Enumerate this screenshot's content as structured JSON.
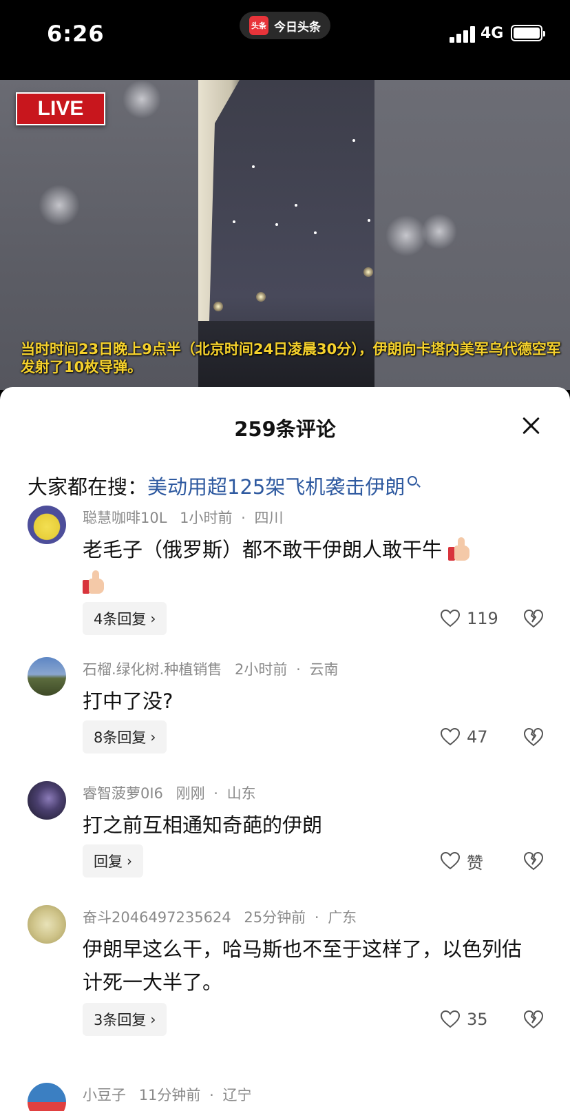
{
  "status_bar": {
    "time": "6:26",
    "app_logo_text": "头条",
    "app_name": "今日头条",
    "network": "4G"
  },
  "video": {
    "live_label": "LIVE",
    "caption": "当时时间23日晚上9点半（北京时间24日凌晨30分），伊朗向卡塔内美军乌代德空军发射了10枚导弹。"
  },
  "comments_sheet": {
    "title": "259条评论",
    "search_prefix": "大家都在搜：",
    "search_link": "美动用超125架飞机袭击伊朗",
    "comments": [
      {
        "user": "聪慧咖啡10L",
        "time": "1小时前",
        "location": "四川",
        "text": "老毛子（俄罗斯）都不敢干伊朗人敢干牛",
        "reply_label": "4条回复",
        "likes": "119"
      },
      {
        "user": "石榴.绿化树.种植销售",
        "time": "2小时前",
        "location": "云南",
        "text": "打中了没?",
        "reply_label": "8条回复",
        "likes": "47"
      },
      {
        "user": "睿智菠萝0I6",
        "time": "刚刚",
        "location": "山东",
        "text": "打之前互相通知奇葩的伊朗",
        "reply_label": "回复",
        "likes": "赞"
      },
      {
        "user": "奋斗2046497235624",
        "time": "25分钟前",
        "location": "广东",
        "text": "伊朗早这么干，哈马斯也不至于这样了，以色列估计死一大半了。",
        "reply_label": "3条回复",
        "likes": "35"
      },
      {
        "user": "小豆子",
        "time": "11分钟前",
        "location": "辽宁"
      }
    ]
  },
  "colors": {
    "link": "#2f5aa0",
    "live_red": "#c8161d",
    "caption_yellow": "#f5d12c"
  }
}
